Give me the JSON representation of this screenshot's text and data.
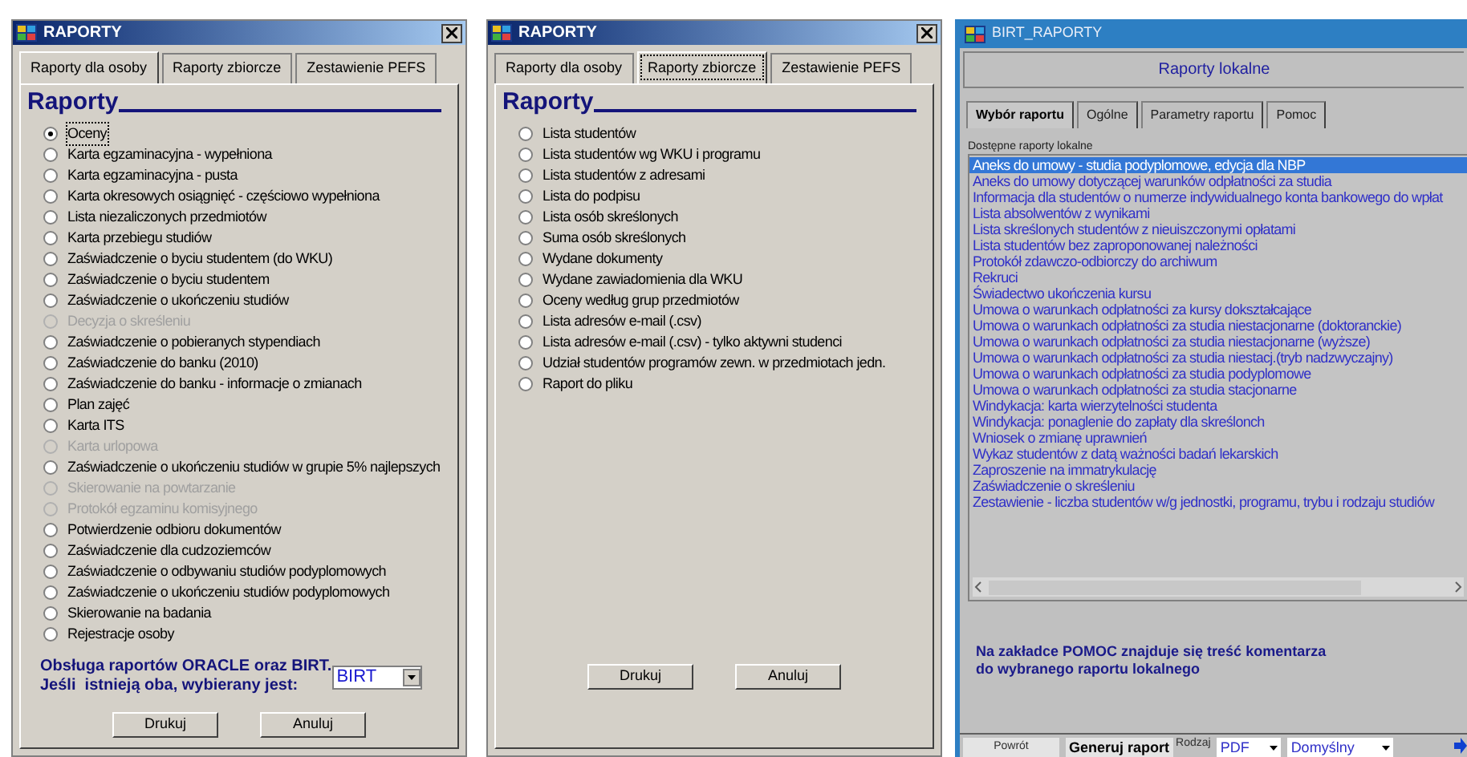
{
  "windows": [
    {
      "title": "RAPORTY",
      "tabs": [
        {
          "label": "Raporty dla osoby",
          "selected": true
        },
        {
          "label": "Raporty zbiorcze",
          "selected": false
        },
        {
          "label": "Zestawienie PEFS",
          "selected": false
        }
      ],
      "heading": "Raporty",
      "options": [
        {
          "label": "Oceny",
          "selected": true,
          "disabled": false
        },
        {
          "label": "Karta egzaminacyjna - wypełniona",
          "selected": false,
          "disabled": false
        },
        {
          "label": "Karta egzaminacyjna - pusta",
          "selected": false,
          "disabled": false
        },
        {
          "label": "Karta okresowych osiągnięć - częściowo wypełniona",
          "selected": false,
          "disabled": false
        },
        {
          "label": "Lista niezaliczonych przedmiotów",
          "selected": false,
          "disabled": false
        },
        {
          "label": "Karta przebiegu studiów",
          "selected": false,
          "disabled": false
        },
        {
          "label": "Zaświadczenie o byciu studentem (do WKU)",
          "selected": false,
          "disabled": false
        },
        {
          "label": "Zaświadczenie o byciu studentem",
          "selected": false,
          "disabled": false
        },
        {
          "label": "Zaświadczenie o ukończeniu studiów",
          "selected": false,
          "disabled": false
        },
        {
          "label": "Decyzja o skreśleniu",
          "selected": false,
          "disabled": true
        },
        {
          "label": "Zaświadczenie o pobieranych stypendiach",
          "selected": false,
          "disabled": false
        },
        {
          "label": "Zaświadczenie do banku (2010)",
          "selected": false,
          "disabled": false
        },
        {
          "label": "Zaświadczenie do banku - informacje o zmianach",
          "selected": false,
          "disabled": false
        },
        {
          "label": "Plan zajęć",
          "selected": false,
          "disabled": false
        },
        {
          "label": "Karta ITS",
          "selected": false,
          "disabled": false
        },
        {
          "label": "Karta urlopowa",
          "selected": false,
          "disabled": true
        },
        {
          "label": "Zaświadczenie o ukończeniu studiów w grupie 5% najlepszych",
          "selected": false,
          "disabled": false
        },
        {
          "label": "Skierowanie na powtarzanie",
          "selected": false,
          "disabled": true
        },
        {
          "label": "Protokół egzaminu komisyjnego",
          "selected": false,
          "disabled": true
        },
        {
          "label": "Potwierdzenie odbioru dokumentów",
          "selected": false,
          "disabled": false
        },
        {
          "label": "Zaświadczenie dla cudzoziemców",
          "selected": false,
          "disabled": false
        },
        {
          "label": "Zaświadczenie o odbywaniu studiów podyplomowych",
          "selected": false,
          "disabled": false
        },
        {
          "label": "Zaświadczenie o ukończeniu studiów podyplomowych",
          "selected": false,
          "disabled": false
        },
        {
          "label": "Skierowanie na badania",
          "selected": false,
          "disabled": false
        },
        {
          "label": "Rejestracje osoby",
          "selected": false,
          "disabled": false
        }
      ],
      "engine_note": [
        "Obsługa raportów ORACLE oraz BIRT.",
        "Jeśli  istnieją oba, wybierany jest:"
      ],
      "engine": "BIRT",
      "buttons": [
        "Drukuj",
        "Anuluj"
      ]
    },
    {
      "title": "RAPORTY",
      "tabs": [
        {
          "label": "Raporty dla osoby",
          "selected": false
        },
        {
          "label": "Raporty zbiorcze",
          "selected": true
        },
        {
          "label": "Zestawienie PEFS",
          "selected": false
        }
      ],
      "heading": "Raporty",
      "options": [
        {
          "label": "Lista studentów",
          "selected": false,
          "disabled": false
        },
        {
          "label": "Lista studentów wg WKU i programu",
          "selected": false,
          "disabled": false
        },
        {
          "label": "Lista studentów z adresami",
          "selected": false,
          "disabled": false
        },
        {
          "label": "Lista do podpisu",
          "selected": false,
          "disabled": false
        },
        {
          "label": "Lista osób skreślonych",
          "selected": false,
          "disabled": false
        },
        {
          "label": "Suma osób skreślonych",
          "selected": false,
          "disabled": false
        },
        {
          "label": "Wydane dokumenty",
          "selected": false,
          "disabled": false
        },
        {
          "label": "Wydane zawiadomienia dla WKU",
          "selected": false,
          "disabled": false
        },
        {
          "label": "Oceny według grup przedmiotów",
          "selected": false,
          "disabled": false
        },
        {
          "label": "Lista adresów e-mail (.csv)",
          "selected": false,
          "disabled": false
        },
        {
          "label": "Lista adresów e-mail (.csv) - tylko aktywni studenci",
          "selected": false,
          "disabled": false
        },
        {
          "label": "Udział studentów programów zewn. w przedmiotach jedn.",
          "selected": false,
          "disabled": false
        },
        {
          "label": "Raport do pliku",
          "selected": false,
          "disabled": false
        }
      ],
      "buttons": [
        "Drukuj",
        "Anuluj"
      ]
    }
  ],
  "birt": {
    "title": "BIRT_RAPORTY",
    "header": "Raporty lokalne",
    "tabs": [
      {
        "label": "Wybór raportu",
        "selected": true
      },
      {
        "label": "Ogólne",
        "selected": false
      },
      {
        "label": "Parametry raportu",
        "selected": false
      },
      {
        "label": "Pomoc",
        "selected": false
      }
    ],
    "list_label": "Dostępne raporty lokalne",
    "reports": [
      {
        "label": "Aneks do umowy - studia podyplomowe, edycja dla NBP",
        "selected": true
      },
      {
        "label": "Aneks do umowy dotyczącej warunków odpłatności za studia",
        "selected": false
      },
      {
        "label": "Informacja dla studentów o numerze indywidualnego konta bankowego do wpłat",
        "selected": false
      },
      {
        "label": "Lista absolwentów z wynikami",
        "selected": false
      },
      {
        "label": "Lista skreślonych studentów z nieuiszczonymi opłatami",
        "selected": false
      },
      {
        "label": "Lista studentów bez zaproponowanej należności",
        "selected": false
      },
      {
        "label": "Protokół zdawczo-odbiorczy do archiwum",
        "selected": false
      },
      {
        "label": "Rekruci",
        "selected": false
      },
      {
        "label": "Świadectwo ukończenia kursu",
        "selected": false
      },
      {
        "label": "Umowa o warunkach odpłatności za kursy dokształcające",
        "selected": false
      },
      {
        "label": "Umowa o warunkach odpłatności za studia niestacjonarne (doktoranckie)",
        "selected": false
      },
      {
        "label": "Umowa o warunkach odpłatności za studia niestacjonarne (wyższe)",
        "selected": false
      },
      {
        "label": "Umowa o warunkach odpłatności za studia niestacj.(tryb nadzwyczajny)",
        "selected": false
      },
      {
        "label": "Umowa o warunkach odpłatności za studia podyplomowe",
        "selected": false
      },
      {
        "label": "Umowa o warunkach odpłatności za studia stacjonarne",
        "selected": false
      },
      {
        "label": "Windykacja: karta wierzytelności studenta",
        "selected": false
      },
      {
        "label": "Windykacja: ponaglenie do zapłaty dla skreślonch",
        "selected": false
      },
      {
        "label": "Wniosek o zmianę uprawnień",
        "selected": false
      },
      {
        "label": "Wykaz studentów z datą ważności badań lekarskich",
        "selected": false
      },
      {
        "label": "Zaproszenie na immatrykulację",
        "selected": false
      },
      {
        "label": "Zaświadczenie o skreśleniu",
        "selected": false
      },
      {
        "label": "Zestawienie - liczba studentów w/g jednostki, programu, trybu i rodzaju studiów",
        "selected": false
      }
    ],
    "comment": [
      "Na zakładce POMOC znajduje się treść komentarza",
      "do wybranego raportu lokalnego"
    ],
    "back_button": "Powrót",
    "generate_button": "Generuj raport",
    "format_label": "Rodzaj",
    "format": "PDF",
    "template": "Domyślny"
  }
}
